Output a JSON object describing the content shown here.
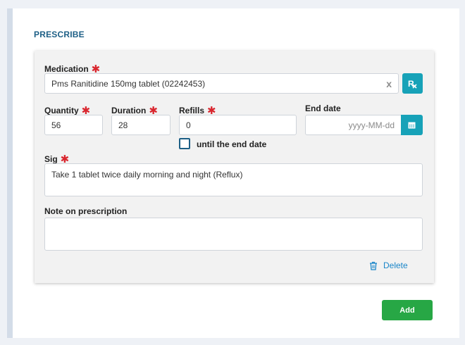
{
  "section": {
    "title": "PRESCRIBE"
  },
  "medication": {
    "label": "Medication",
    "required": "✱",
    "value": "Pms Ranitidine 150mg tablet (02242453)",
    "clear": "x"
  },
  "quantity": {
    "label": "Quantity",
    "required": "✱",
    "value": "56"
  },
  "duration": {
    "label": "Duration",
    "required": "✱",
    "value": "28"
  },
  "refills": {
    "label": "Refills",
    "required": "✱",
    "value": "0",
    "until_end_label": "until the end date",
    "until_end_checked": false
  },
  "end_date": {
    "label": "End date",
    "placeholder": "yyyy-MM-dd"
  },
  "sig": {
    "label": "Sig",
    "required": "✱",
    "value": "Take 1 tablet twice daily morning and night (Reflux)"
  },
  "note": {
    "label": "Note on prescription",
    "value": ""
  },
  "actions": {
    "delete_label": "Delete",
    "add_label": "Add"
  },
  "colors": {
    "accent": "#17a2b8",
    "required": "#d9262e",
    "add": "#27a745",
    "link": "#1a86c9",
    "title": "#1d5f86"
  }
}
